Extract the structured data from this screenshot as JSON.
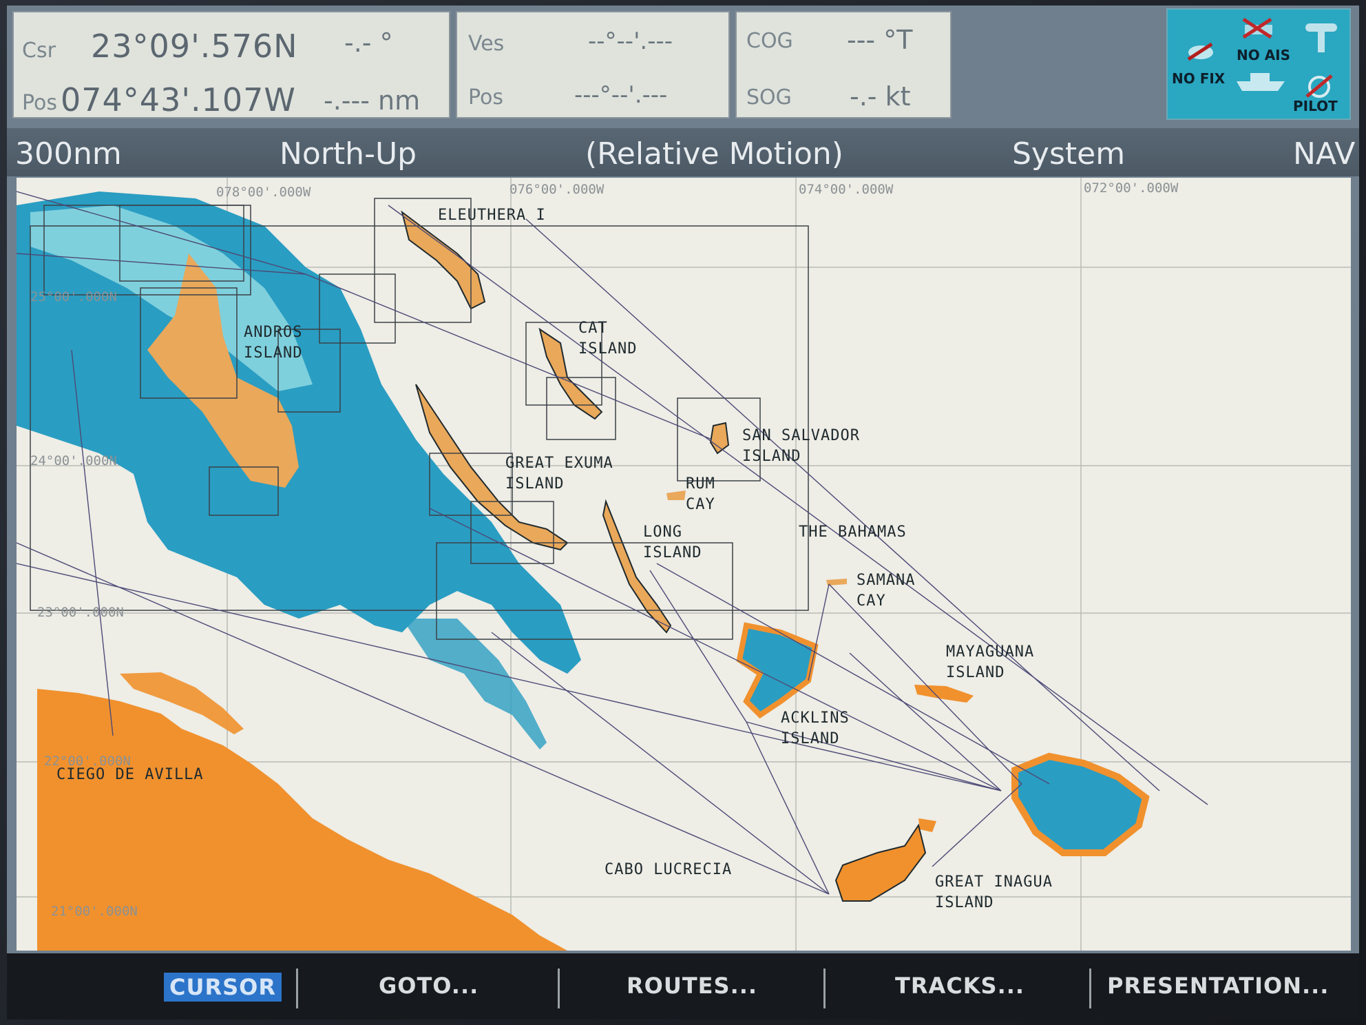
{
  "header": {
    "csr_label": "Csr",
    "pos_label": "Pos",
    "latitude": "23°09'.576N",
    "longitude": "074°43'.107W",
    "bearing": "-.- °",
    "distance": "-.--- nm",
    "ves_label": "Ves",
    "ves_pos_label": "Pos",
    "ves_lat": "--°--'.---",
    "ves_lon": "---°--'.---",
    "cog_label": "COG",
    "cog_value": "--- °T",
    "sog_label": "SOG",
    "sog_value": "-.- kt"
  },
  "status": {
    "no_fix": "NO FIX",
    "no_ais": "NO AIS",
    "pilot": "PILOT"
  },
  "titlebar": {
    "range": "300nm",
    "orientation": "North-Up",
    "motion": "(Relative Motion)",
    "datum": "System",
    "mode": "NAV"
  },
  "map": {
    "grid_labels": {
      "lon_76": "076°00'.000W",
      "lon_74": "074°00'.000W",
      "lon_72": "072°00'.000W",
      "lon_78": "078°00'.000W",
      "lat_25": "25°00'.000N",
      "lat_24": "24°00'.000N",
      "lat_23": "23°00'.000N",
      "lat_22": "22°00'.000N",
      "lat_21": "21°00'.000N"
    },
    "places": {
      "eleuthera": "ELEUTHERA I",
      "cat": "CAT\nISLAND",
      "andros": "ANDROS\nISLAND",
      "san_salvador": "SAN SALVADOR\nISLAND",
      "great_exuma": "GREAT EXUMA\nISLAND",
      "rum_cay": "RUM\nCAY",
      "long_island": "LONG\nISLAND",
      "bahamas": "THE BAHAMAS",
      "samana": "SAMANA\nCAY",
      "mayaguana": "MAYAGUANA\nISLAND",
      "acklins": "ACKLINS\nISLAND",
      "ciego": "CIEGO DE AVILLA",
      "cabo": "CABO LUCRECIA",
      "inagua": "GREAT INAGUA\nISLAND"
    }
  },
  "softkeys": {
    "cursor": "CURSOR",
    "goto": "GOTO...",
    "routes": "ROUTES...",
    "tracks": "TRACKS...",
    "presentation": "PRESENTATION..."
  },
  "colors": {
    "land": "#f0912e",
    "island": "#e9a85a",
    "shallow": "#2a9dc2",
    "shoal": "#7fd0dd",
    "sea": "#eeede6"
  }
}
